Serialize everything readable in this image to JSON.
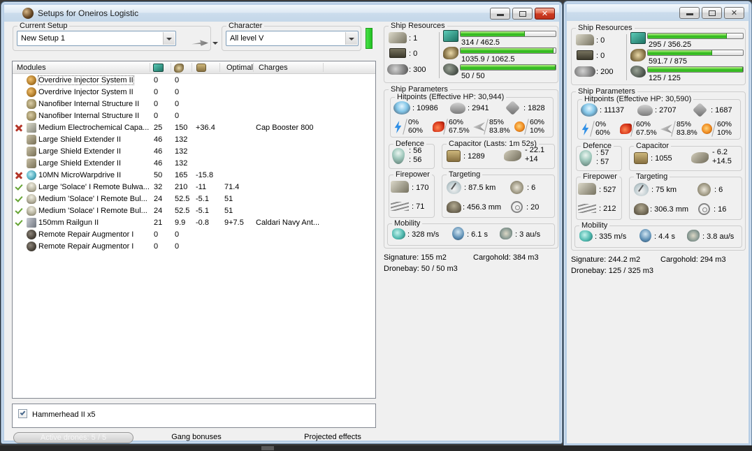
{
  "windows": {
    "main": {
      "title": "Setups for Oneiros Logistic",
      "current_setup": {
        "label": "Current Setup",
        "value": "New Setup 1"
      },
      "character": {
        "label": "Character",
        "value": "All level V"
      }
    },
    "secondary": {
      "title": ""
    }
  },
  "main": {
    "modules_table": {
      "headers": {
        "modules": "Modules",
        "optimal": "Optimal",
        "charges": "Charges"
      },
      "rows": [
        {
          "focused": true,
          "status": "",
          "icon": "overdrive-injector-icon",
          "name": "Overdrive Injector System II",
          "cpu": "0",
          "pg": "0",
          "cap": "",
          "optimal": "",
          "charges": ""
        },
        {
          "focused": false,
          "status": "",
          "icon": "overdrive-injector-icon",
          "name": "Overdrive Injector System II",
          "cpu": "0",
          "pg": "0",
          "cap": "",
          "optimal": "",
          "charges": ""
        },
        {
          "focused": false,
          "status": "",
          "icon": "nanofiber-icon",
          "name": "Nanofiber Internal Structure II",
          "cpu": "0",
          "pg": "0",
          "cap": "",
          "optimal": "",
          "charges": ""
        },
        {
          "focused": false,
          "status": "",
          "icon": "nanofiber-icon",
          "name": "Nanofiber Internal Structure II",
          "cpu": "0",
          "pg": "0",
          "cap": "",
          "optimal": "",
          "charges": ""
        },
        {
          "focused": false,
          "status": "offline",
          "icon": "cap-injector-icon",
          "name": "Medium Electrochemical Capa...",
          "cpu": "25",
          "pg": "150",
          "cap": "+36.4",
          "optimal": "",
          "charges": "Cap Booster 800"
        },
        {
          "focused": false,
          "status": "",
          "icon": "shield-extender-icon",
          "name": "Large Shield Extender II",
          "cpu": "46",
          "pg": "132",
          "cap": "",
          "optimal": "",
          "charges": ""
        },
        {
          "focused": false,
          "status": "",
          "icon": "shield-extender-icon",
          "name": "Large Shield Extender II",
          "cpu": "46",
          "pg": "132",
          "cap": "",
          "optimal": "",
          "charges": ""
        },
        {
          "focused": false,
          "status": "",
          "icon": "shield-extender-icon",
          "name": "Large Shield Extender II",
          "cpu": "46",
          "pg": "132",
          "cap": "",
          "optimal": "",
          "charges": ""
        },
        {
          "focused": false,
          "status": "offline",
          "icon": "mwd-icon",
          "name": "10MN MicroWarpdrive II",
          "cpu": "50",
          "pg": "165",
          "cap": "-15.8",
          "optimal": "",
          "charges": ""
        },
        {
          "focused": false,
          "status": "active",
          "icon": "solace-repper-icon",
          "name": "Large 'Solace' I Remote Bulwa...",
          "cpu": "32",
          "pg": "210",
          "cap": "-11",
          "optimal": "71.4",
          "charges": ""
        },
        {
          "focused": false,
          "status": "active",
          "icon": "solace-repper-icon",
          "name": "Medium 'Solace' I Remote Bul...",
          "cpu": "24",
          "pg": "52.5",
          "cap": "-5.1",
          "optimal": "51",
          "charges": ""
        },
        {
          "focused": false,
          "status": "active",
          "icon": "solace-repper-icon",
          "name": "Medium 'Solace' I Remote Bul...",
          "cpu": "24",
          "pg": "52.5",
          "cap": "-5.1",
          "optimal": "51",
          "charges": ""
        },
        {
          "focused": false,
          "status": "active",
          "icon": "railgun-icon",
          "name": "150mm Railgun II",
          "cpu": "21",
          "pg": "9.9",
          "cap": "-0.8",
          "optimal": "9+7.5",
          "charges": "Caldari Navy Ant..."
        },
        {
          "focused": false,
          "status": "",
          "icon": "remote-repair-augmentor-icon",
          "name": "Remote Repair Augmentor I",
          "cpu": "0",
          "pg": "0",
          "cap": "",
          "optimal": "",
          "charges": ""
        },
        {
          "focused": false,
          "status": "",
          "icon": "remote-repair-augmentor-icon",
          "name": "Remote Repair Augmentor I",
          "cpu": "0",
          "pg": "0",
          "cap": "",
          "optimal": "",
          "charges": ""
        }
      ]
    },
    "drone_list": {
      "items": [
        {
          "checked": true,
          "label": "Hammerhead II x5"
        }
      ]
    },
    "footer_tabs": {
      "active_drones": "Active drones: 5 / 5",
      "gang_bonuses": "Gang bonuses",
      "projected_effects": "Projected effects"
    }
  },
  "panels": [
    {
      "resources": {
        "title": "Ship Resources",
        "turrets": ": 1",
        "launchers": ": 0",
        "calibration": ": 300",
        "cpu": "314 / 462.5",
        "powergrid": "1035.9 / 1062.5",
        "drones": "50 / 50"
      },
      "parameters_title": "Ship Parameters",
      "hitpoints": {
        "title": "Hitpoints (Effective HP: 30,944)",
        "shield": ": 10986",
        "armor": ": 2941",
        "structure": ": 1828",
        "resists": [
          {
            "top": "0%",
            "bottom": "60%"
          },
          {
            "top": "60%",
            "bottom": "67.5%"
          },
          {
            "top": "85%",
            "bottom": "83.8%"
          },
          {
            "top": "60%",
            "bottom": "10%"
          }
        ]
      },
      "defence": {
        "title": "Defence",
        "line1": ": 56",
        "line2": ": 56"
      },
      "capacitor": {
        "title": "Capacitor (Lasts: 1m 52s)",
        "amount": ": 1289",
        "peak": "- 22.1",
        "recharge": "+14"
      },
      "firepower": {
        "title": "Firepower",
        "turret": ": 170",
        "missile": ": 71"
      },
      "targeting": {
        "title": "Targeting",
        "range": ": 87.5 km",
        "max_targets": ": 6",
        "scan_resolution": ": 456.3 mm",
        "sensor_strength": ": 20"
      },
      "mobility": {
        "title": "Mobility",
        "speed": ": 328 m/s",
        "align_time": ": 6.1 s",
        "warp_speed": ": 3 au/s"
      },
      "signature": "Signature: 155 m2",
      "cargohold": "Cargohold: 384 m3",
      "dronebay": "Dronebay: 50 / 50 m3"
    },
    {
      "resources": {
        "title": "Ship Resources",
        "turrets": ": 0",
        "launchers": ": 0",
        "calibration": ": 200",
        "cpu": "295 / 356.25",
        "powergrid": "591.7 / 875",
        "drones": "125 / 125"
      },
      "parameters_title": "Ship Parameters",
      "hitpoints": {
        "title": "Hitpoints (Effective HP: 30,590)",
        "shield": ": 11137",
        "armor": ": 2707",
        "structure": ": 1687",
        "resists": [
          {
            "top": "0%",
            "bottom": "60%"
          },
          {
            "top": "60%",
            "bottom": "67.5%"
          },
          {
            "top": "85%",
            "bottom": "83.8%"
          },
          {
            "top": "60%",
            "bottom": "10%"
          }
        ]
      },
      "defence": {
        "title": "Defence",
        "line1": ": 57",
        "line2": ": 57"
      },
      "capacitor": {
        "title": "Capacitor",
        "amount": ": 1055",
        "peak": "- 6.2",
        "recharge": "+14.5"
      },
      "firepower": {
        "title": "Firepower",
        "turret": ": 527",
        "missile": ": 212"
      },
      "targeting": {
        "title": "Targeting",
        "range": ": 75 km",
        "max_targets": ": 6",
        "scan_resolution": ": 306.3 mm",
        "sensor_strength": ": 16"
      },
      "mobility": {
        "title": "Mobility",
        "speed": ": 335 m/s",
        "align_time": ": 4.4 s",
        "warp_speed": ": 3.8 au/s"
      },
      "signature": "Signature: 244.2 m2",
      "cargohold": "Cargohold: 294 m3",
      "dronebay": "Dronebay: 125 / 325 m3"
    }
  ]
}
